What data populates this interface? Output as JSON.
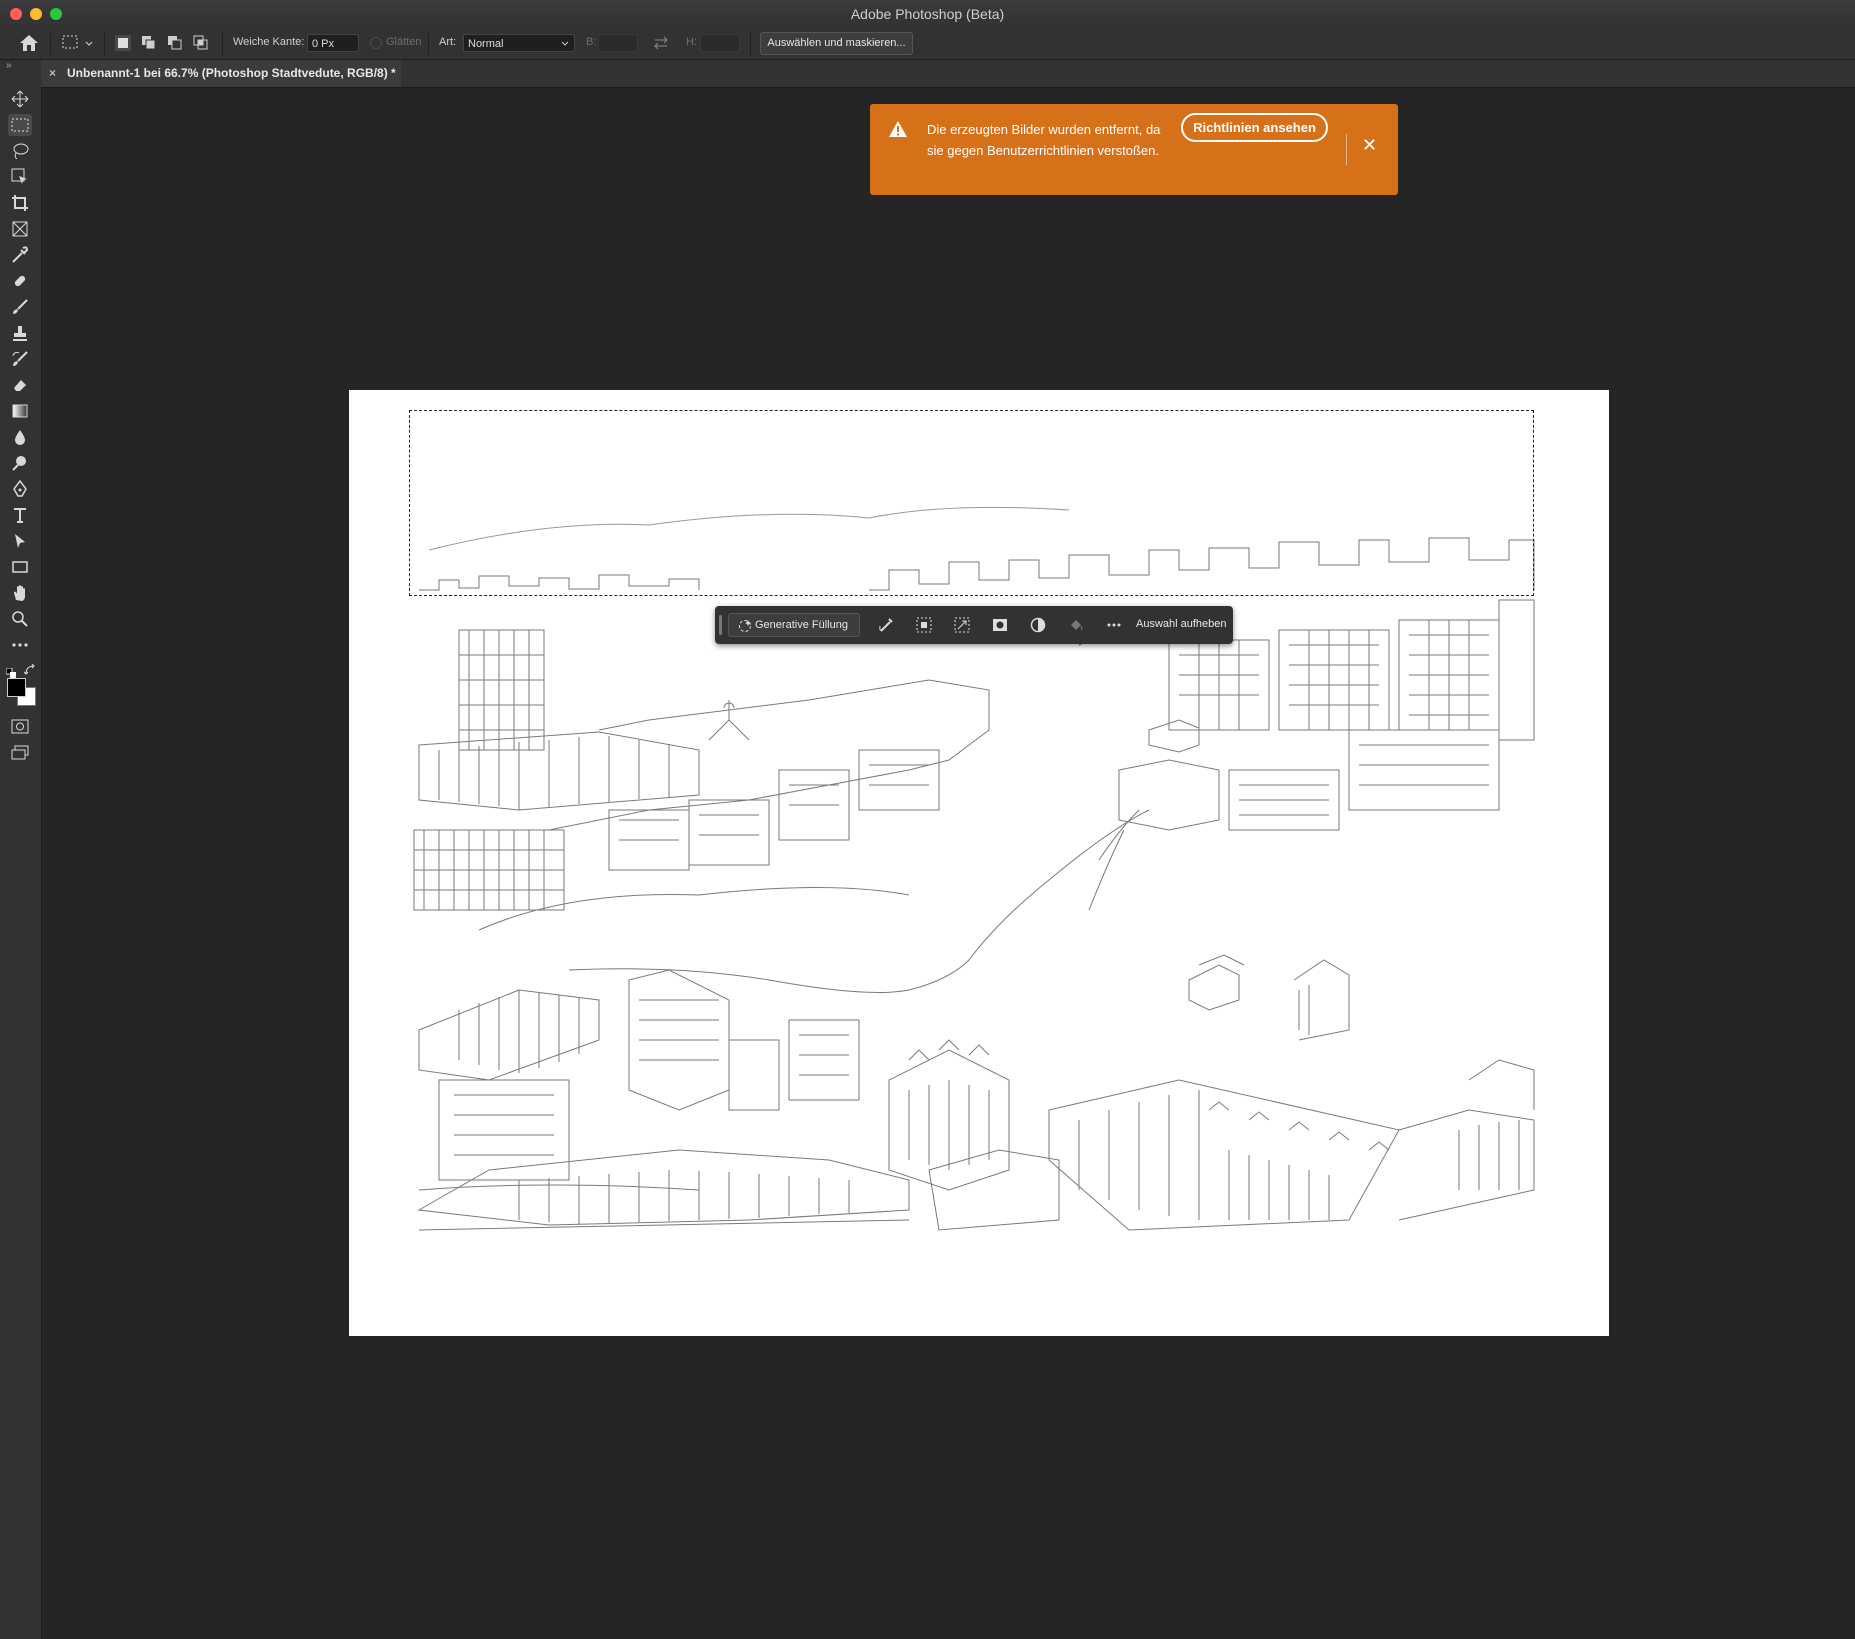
{
  "window": {
    "title": "Adobe Photoshop (Beta)"
  },
  "options_bar": {
    "feather_label": "Weiche Kante:",
    "feather_value": "0 Px",
    "antialias_label": "Glätten",
    "style_label": "Art:",
    "style_value": "Normal",
    "width_label": "B:",
    "height_label": "H:",
    "select_mask_label": "Auswählen und maskieren..."
  },
  "document_tab": {
    "close_glyph": "×",
    "label": "Unbenannt-1 bei 66.7% (Photoshop Stadtvedute, RGB/8) *"
  },
  "notification": {
    "message": "Die erzeugten Bilder wurden entfernt, da sie gegen Benutzerrichtlinien verstoßen.",
    "button_label": "Richtlinien ansehen",
    "close_glyph": "✕",
    "color": "#d6711a"
  },
  "task_bar": {
    "generative_fill_label": "Generative Füllung",
    "deselect_label": "Auswahl aufheben"
  },
  "tools": [
    "move-tool-icon",
    "marquee-tool-icon",
    "lasso-tool-icon",
    "object-select-tool-icon",
    "crop-tool-icon",
    "frame-tool-icon",
    "eyedropper-tool-icon",
    "healing-brush-icon",
    "brush-tool-icon",
    "clone-stamp-icon",
    "history-brush-icon",
    "eraser-tool-icon",
    "gradient-tool-icon",
    "blur-tool-icon",
    "dodge-tool-icon",
    "pen-tool-icon",
    "type-tool-icon",
    "path-select-icon",
    "rectangle-tool-icon",
    "hand-tool-icon",
    "zoom-tool-icon",
    "more-tools-icon"
  ],
  "colors": {
    "foreground": "#000000",
    "background": "#ffffff",
    "accent": "#d6711a"
  }
}
